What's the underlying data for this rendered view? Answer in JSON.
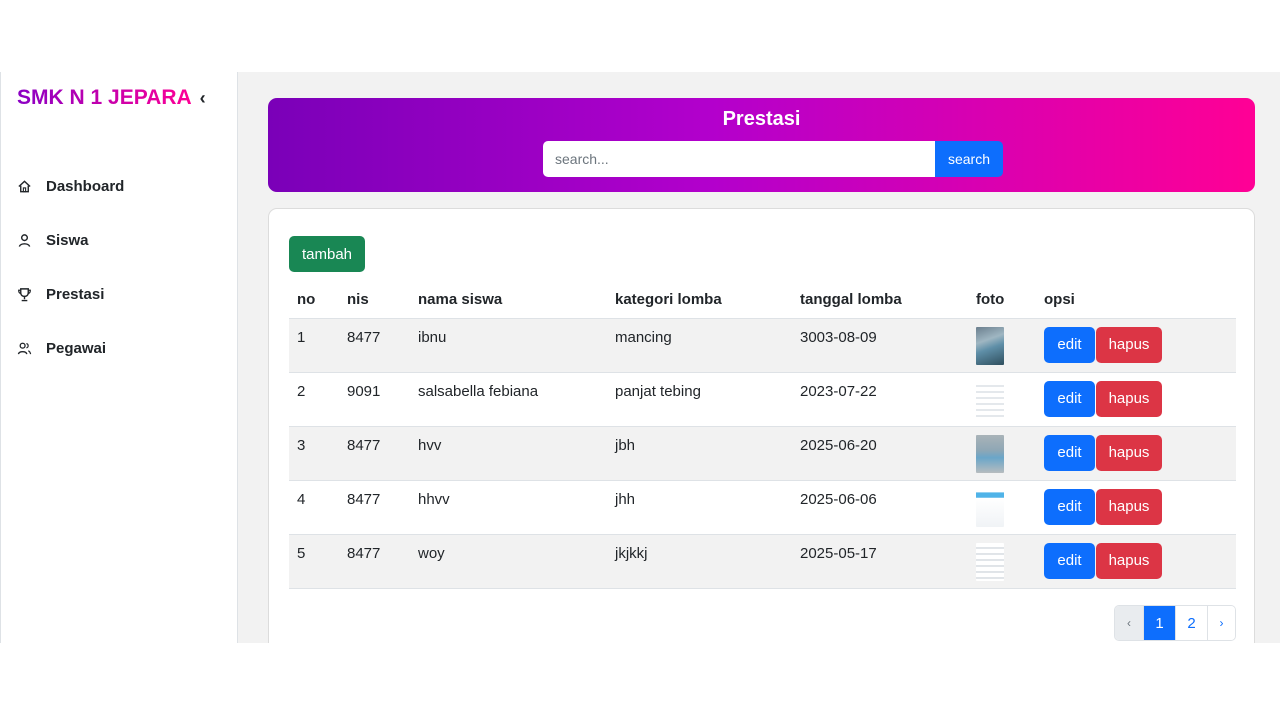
{
  "sidebar": {
    "brand": "SMK N 1 JEPARA",
    "toggle": "‹",
    "items": [
      {
        "label": "Dashboard",
        "icon": "home-icon"
      },
      {
        "label": "Siswa",
        "icon": "user-icon"
      },
      {
        "label": "Prestasi",
        "icon": "trophy-icon"
      },
      {
        "label": "Pegawai",
        "icon": "users-icon"
      }
    ]
  },
  "header": {
    "title": "Prestasi",
    "search_placeholder": "search...",
    "search_label": "search"
  },
  "toolbar": {
    "add_label": "tambah"
  },
  "table": {
    "headers": [
      "no",
      "nis",
      "nama siswa",
      "kategori lomba",
      "tanggal lomba",
      "foto",
      "opsi"
    ],
    "rows": [
      {
        "no": "1",
        "nis": "8477",
        "nama": "ibnu",
        "kategori": "mancing",
        "tanggal": "3003-08-09"
      },
      {
        "no": "2",
        "nis": "9091",
        "nama": "salsabella febiana",
        "kategori": "panjat tebing",
        "tanggal": "2023-07-22"
      },
      {
        "no": "3",
        "nis": "8477",
        "nama": "hvv",
        "kategori": "jbh",
        "tanggal": "2025-06-20"
      },
      {
        "no": "4",
        "nis": "8477",
        "nama": "hhvv",
        "kategori": "jhh",
        "tanggal": "2025-06-06"
      },
      {
        "no": "5",
        "nis": "8477",
        "nama": "woy",
        "kategori": "jkjkkj",
        "tanggal": "2025-05-17"
      }
    ],
    "edit_label": "edit",
    "delete_label": "hapus"
  },
  "pagination": {
    "prev": "‹",
    "pages": [
      "1",
      "2"
    ],
    "next": "›",
    "current": "1"
  },
  "colors": {
    "brand_gradient_start": "#7a00b8",
    "brand_gradient_end": "#ff0095",
    "primary": "#0d6efd",
    "success": "#198754",
    "danger": "#dc3545"
  }
}
